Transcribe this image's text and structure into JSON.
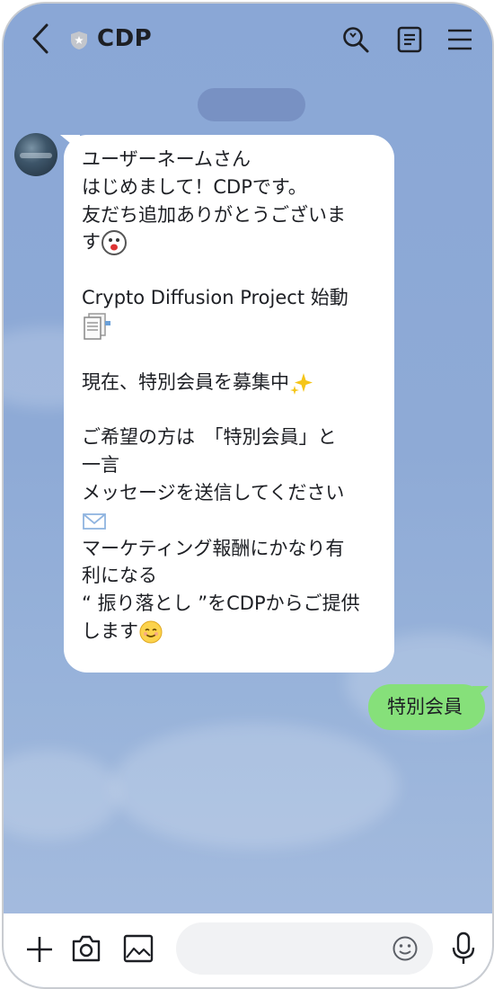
{
  "header": {
    "title": "CDP",
    "back_icon": "chevron-left-icon",
    "verified_icon": "shield-star-icon",
    "search_icon": "search-icon",
    "notes_icon": "notes-icon",
    "menu_icon": "menu-icon"
  },
  "incoming_message": {
    "lines": [
      "ユーザーネームさん",
      "はじめまして！CDPです。",
      "友だち追加ありがとうございま",
      "す",
      "",
      "Crypto Diffusion Project 始動",
      "",
      "",
      "現在、特別会員を募集中",
      "",
      "ご希望の方は　「特別会員」と",
      "一言",
      "メッセージを送信してください",
      "",
      "マーケティング報酬にかなり有",
      "利になる",
      "“ 振り落とし ”をCDPからご提供",
      "します"
    ]
  },
  "outgoing_message": {
    "text": "特別会員"
  },
  "footer": {
    "plus_icon": "plus-icon",
    "camera_icon": "camera-icon",
    "image_icon": "image-icon",
    "emoji_icon": "emoji-icon",
    "mic_icon": "microphone-icon",
    "input_placeholder": ""
  },
  "colors": {
    "chat_background": "#8eabd6",
    "incoming_bubble": "#ffffff",
    "outgoing_bubble": "#86e07a"
  }
}
